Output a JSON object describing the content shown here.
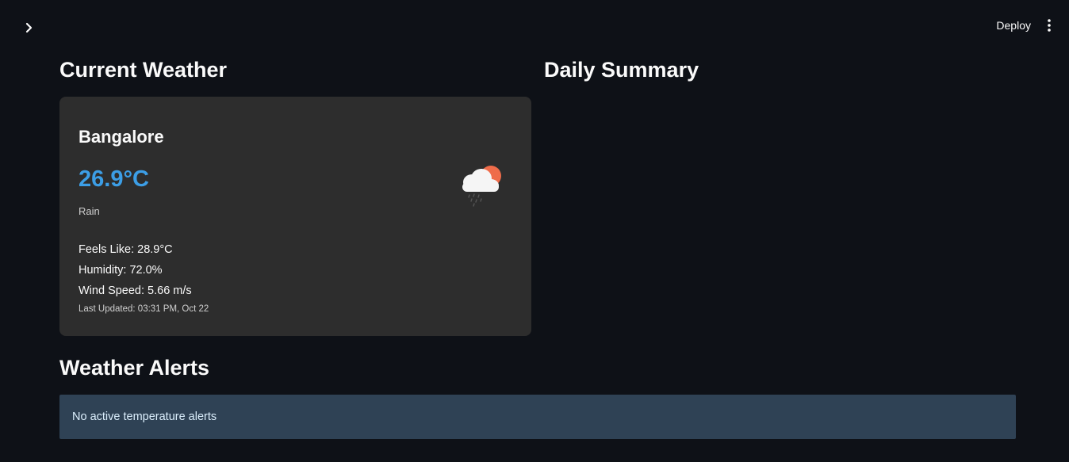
{
  "header": {
    "deploy_label": "Deploy"
  },
  "current_weather": {
    "heading": "Current Weather",
    "city": "Bangalore",
    "temperature": "26.9°C",
    "condition": "Rain",
    "feels_like": "Feels Like: 28.9°C",
    "humidity": "Humidity: 72.0%",
    "wind_speed": "Wind Speed: 5.66 m/s",
    "last_updated": "Last Updated: 03:31 PM, Oct 22",
    "icon": "rain-cloud-sun-icon",
    "temperature_color": "#3c9ee6"
  },
  "daily_summary": {
    "heading": "Daily Summary"
  },
  "alerts": {
    "heading": "Weather Alerts",
    "message": "No active temperature alerts"
  },
  "colors": {
    "background": "#0e1117",
    "card": "#2d2d2d",
    "alert_bg": "#2f4255",
    "alert_text": "#dbeefc"
  }
}
